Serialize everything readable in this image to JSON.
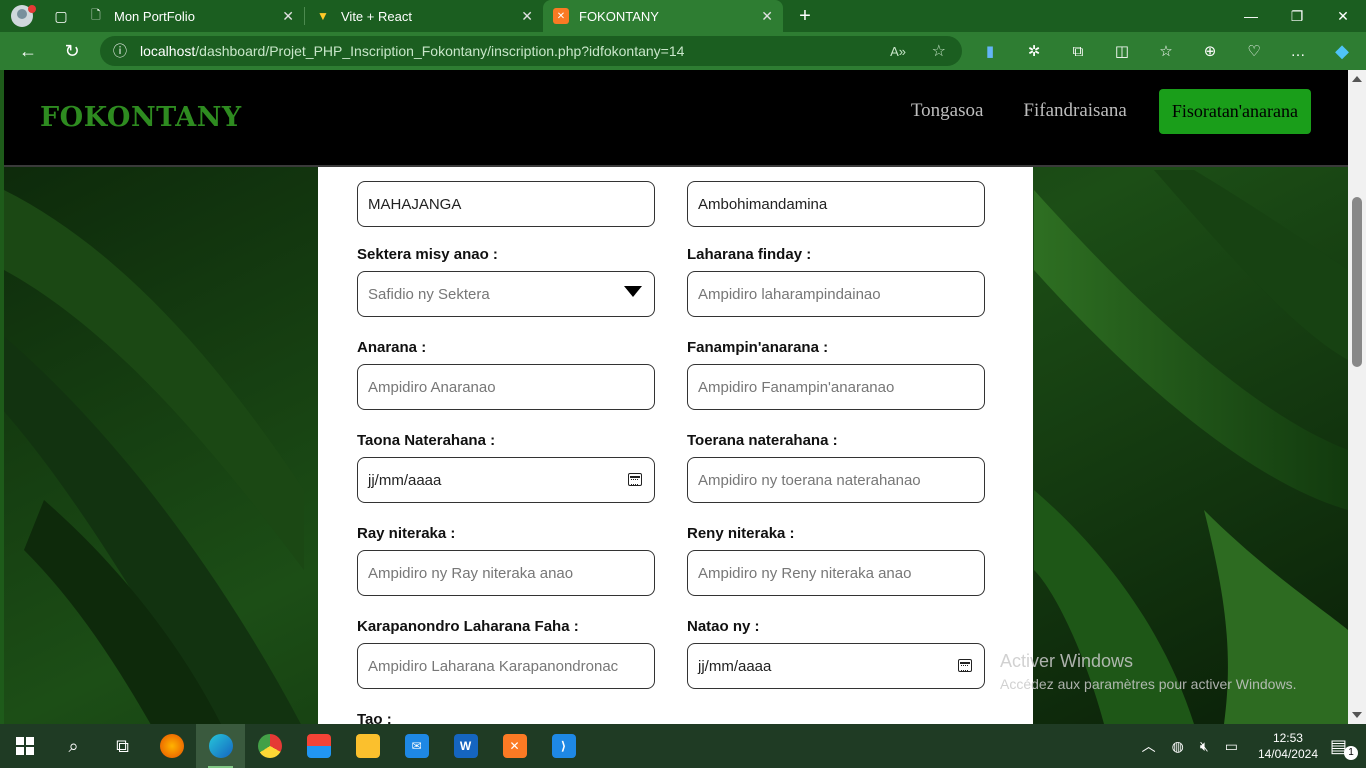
{
  "browser": {
    "tabs": [
      {
        "title": "Mon PortFolio",
        "icon": "page-icon"
      },
      {
        "title": "Vite + React",
        "icon": "vite-icon"
      },
      {
        "title": "FOKONTANY",
        "icon": "xampp-icon",
        "active": true
      }
    ],
    "address": {
      "host": "localhost",
      "path": "/dashboard/Projet_PHP_Inscription_Fokontany/inscription.php?idfokontany=14"
    }
  },
  "site": {
    "brand": "FOKONTANY",
    "nav": {
      "home": "Tongasoa",
      "contact": "Fifandraisana",
      "register": "Fisoratan'anarana"
    }
  },
  "form": {
    "region_value": "MAHAJANGA",
    "fokontany_value": "Ambohimandamina",
    "sector": {
      "label": "Sektera misy anao :",
      "placeholder": "Safidio ny Sektera"
    },
    "phone": {
      "label": "Laharana finday :",
      "placeholder": "Ampidiro laharampindainao"
    },
    "lastname": {
      "label": "Anarana :",
      "placeholder": "Ampidiro Anaranao"
    },
    "firstname": {
      "label": "Fanampin'anarana :",
      "placeholder": "Ampidiro Fanampin'anaranao"
    },
    "birthdate": {
      "label": "Taona Naterahana :",
      "value": "jj/mm/aaaa"
    },
    "birthplace": {
      "label": "Toerana naterahana :",
      "placeholder": "Ampidiro ny toerana naterahanao"
    },
    "father": {
      "label": "Ray niteraka :",
      "placeholder": "Ampidiro ny Ray niteraka anao"
    },
    "mother": {
      "label": "Reny niteraka :",
      "placeholder": "Ampidiro ny Reny niteraka anao"
    },
    "idcard": {
      "label": "Karapanondro Laharana Faha :",
      "placeholder": "Ampidiro Laharana Karapanondronac"
    },
    "issued": {
      "label": "Natao ny :",
      "value": "jj/mm/aaaa"
    },
    "next_label": "Tao :"
  },
  "windows_watermark": {
    "line1": "Activer Windows",
    "line2": "Accédez aux paramètres pour activer Windows."
  },
  "taskbar": {
    "time": "12:53",
    "date": "14/04/2024",
    "notifications": "1"
  },
  "colors": {
    "brand": "#2e8b20",
    "cta": "#1a9e1a",
    "browser_frame": "#1b5e20"
  }
}
